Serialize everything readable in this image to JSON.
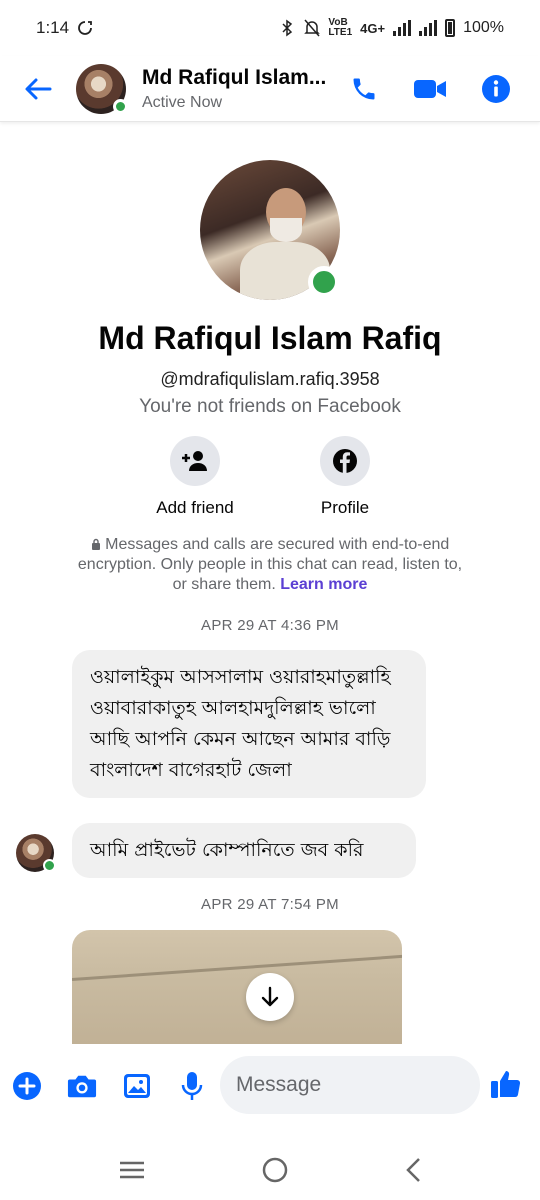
{
  "status_bar": {
    "time": "1:14",
    "network_top": "VoB",
    "network_bottom": "LTE1",
    "signal_label": "4G+",
    "battery": "100%"
  },
  "header": {
    "name": "Md Rafiqul Islam...",
    "status": "Active Now"
  },
  "profile": {
    "name": "Md Rafiqul Islam Rafiq",
    "handle": "@mdrafiqulislam.rafiq.3958",
    "note": "You're not friends on Facebook",
    "actions": [
      {
        "label": "Add friend"
      },
      {
        "label": "Profile"
      }
    ]
  },
  "encryption": {
    "text": "Messages and calls are secured with end-to-end encryption. Only people in this chat can read, listen to, or share them.",
    "link": "Learn more"
  },
  "messages": [
    {
      "timestamp": "APR 29 AT 4:36 PM"
    },
    {
      "text": "ওয়ালাইকুম আসসালাম ওয়ারাহমাতুল্লাহি ওয়াবারাকাতুহ আলহামদুলিল্লাহ ভালো আছি আপনি কেমন আছেন আমার বাড়ি বাংলাদেশ বাগেরহাট জেলা"
    },
    {
      "text": "আমি প্রাইভেট কোম্পানিতে জব করি"
    },
    {
      "timestamp": "APR 29 AT 7:54 PM"
    }
  ],
  "composer": {
    "placeholder": "Message"
  },
  "colors": {
    "accent": "#0866ff",
    "online": "#31a24c",
    "link": "#5b3fd3",
    "bubble": "#f0f0f0"
  },
  "icons": {
    "back": "arrow-left-icon",
    "call": "phone-icon",
    "video": "video-camera-icon",
    "info": "info-icon",
    "add_friend": "person-add-icon",
    "profile": "facebook-icon",
    "lock": "lock-icon",
    "scroll": "arrow-down-icon",
    "plus": "plus-icon",
    "camera": "camera-icon",
    "gallery": "image-icon",
    "mic": "microphone-icon",
    "emoji": "emoji-icon",
    "like": "thumbs-up-icon"
  }
}
